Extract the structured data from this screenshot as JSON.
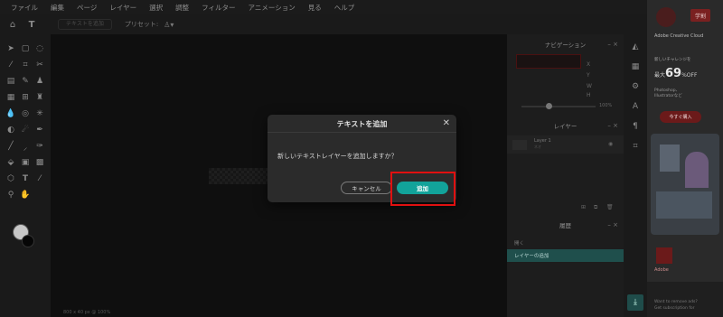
{
  "menubar": [
    "ファイル",
    "編集",
    "ページ",
    "レイヤー",
    "選択",
    "調整",
    "フィルター",
    "アニメーション",
    "見る",
    "ヘルプ"
  ],
  "toolbar": {
    "text_button": "テキストを追加",
    "preset_label": "プリセット:"
  },
  "right_panel": {
    "navigator_title": "ナビゲーション",
    "zoom": "100%",
    "layers_title": "レイヤー",
    "layer_name": "Layer 1",
    "layer_sub": "ネオ",
    "history_title": "履歴",
    "history_item_1": "開く",
    "history_item_2": "レイヤーの追加"
  },
  "status": "800 x 40 px @ 100%",
  "dialog": {
    "title": "テキストを追加",
    "message": "新しいテキストレイヤーを追加しますか？",
    "cancel_label": "キャンセル",
    "add_label": "追加"
  },
  "ad": {
    "sale_badge": "学割",
    "brand": "Adobe Creative Cloud",
    "copy": "新しいチャレンジを",
    "pct_prefix": "最大",
    "pct_value": "69",
    "pct_suffix": "%OFF",
    "apps_line1": "Photoshop、",
    "apps_line2": "Illustratorなど",
    "cta": "今すぐ購入",
    "adobe_label": "Adobe",
    "footer_line1": "Want to remove ads?",
    "footer_line2": "Get subscription for"
  },
  "colors": {
    "accent": "#12a39a",
    "highlight": "#e01010",
    "history_active_bg": "#1f4f4c"
  }
}
